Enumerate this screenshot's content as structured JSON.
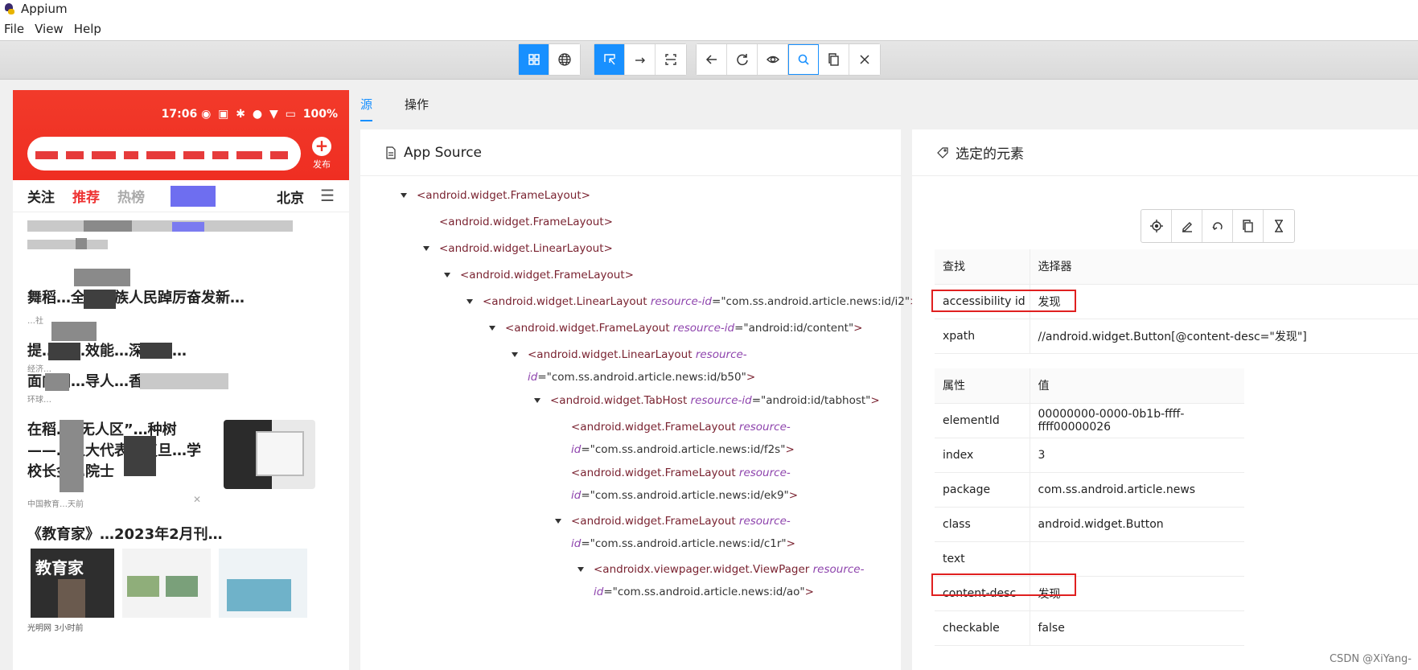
{
  "window": {
    "title": "Appium"
  },
  "menubar": {
    "items": [
      "File",
      "View",
      "Help"
    ]
  },
  "toolbar": {
    "group1": [
      "grid-icon",
      "globe-icon"
    ],
    "group2": [
      "select-element-icon",
      "swipe-icon",
      "tap-coordinates-icon"
    ],
    "group3": [
      "back-icon",
      "refresh-icon",
      "eye-icon",
      "search-icon",
      "copy-icon",
      "close-icon"
    ]
  },
  "device": {
    "status_time": "17:06",
    "status_battery": "100%",
    "publish_label": "发布",
    "tabs": [
      "关注",
      "推荐",
      "热榜"
    ],
    "city_tab": "北京",
    "news": [
      {
        "headline": "舞稻…全…各族人民踔厉奋发新…",
        "meta": "…社"
      },
      {
        "headline": "提…治…效能…深刻变…",
        "meta": "经济…"
      },
      {
        "headline": "面向国…导人…香乡…",
        "meta": "环球…"
      },
      {
        "headline": "在稻…“无人区”…种树——…人大代表、复旦…学校长金…院士",
        "meta": "中国教育…天前"
      },
      {
        "headline": "《教育家》…2023年2月刊…",
        "meta": "光明网  3小时前"
      }
    ],
    "thumb_caption": "教育家"
  },
  "tabs": {
    "source": "源",
    "actions": "操作"
  },
  "source_panel": {
    "title": "App Source",
    "nodes": [
      {
        "tag": "<android.widget.FrameLayout>"
      },
      {
        "tag": "<android.widget.FrameLayout>"
      },
      {
        "tag": "<android.widget.LinearLayout>"
      },
      {
        "tag": "<android.widget.FrameLayout>"
      },
      {
        "tag": "<android.widget.LinearLayout",
        "attr": "resource-id",
        "value": "\"com.ss.android.article.news:id/i2\"",
        "end": ">"
      },
      {
        "tag": "<android.widget.FrameLayout",
        "attr": "resource-id",
        "value": "\"android:id/content\"",
        "end": ">"
      },
      {
        "tag": "<android.widget.LinearLayout",
        "attr": "resource-",
        "line2_attr": "id",
        "value": "\"com.ss.android.article.news:id/b50\"",
        "end": ">"
      },
      {
        "tag": "<android.widget.TabHost",
        "attr": "resource-id",
        "value": "\"android:id/tabhost\"",
        "end": ">"
      },
      {
        "tag": "<android.widget.FrameLayout",
        "attr": "resource-",
        "line2_attr": "id",
        "value": "\"com.ss.android.article.news:id/f2s\"",
        "end": ">"
      },
      {
        "tag": "<android.widget.FrameLayout",
        "attr": "resource-",
        "line2_attr": "id",
        "value": "\"com.ss.android.article.news:id/ek9\"",
        "end": ">"
      },
      {
        "tag": "<android.widget.FrameLayout",
        "attr": "resource-",
        "line2_attr": "id",
        "value": "\"com.ss.android.article.news:id/c1r\"",
        "end": ">"
      },
      {
        "tag": "<androidx.viewpager.widget.ViewPager",
        "attr": "resource-",
        "line2_attr": "id",
        "value": "\"com.ss.android.article.news:id/ao\"",
        "end": ">"
      }
    ]
  },
  "selected_panel": {
    "title": "选定的元素",
    "actions": [
      "tap-element-icon",
      "send-keys-icon",
      "clear-icon",
      "copy-attributes-icon",
      "timing-icon"
    ],
    "find_header": [
      "查找",
      "选择器"
    ],
    "selectors": [
      {
        "key": "accessibility id",
        "value": "发现"
      },
      {
        "key": "xpath",
        "value": "//android.widget.Button[@content-desc=\"发现\"]"
      }
    ],
    "attr_header": [
      "属性",
      "值"
    ],
    "attributes": [
      {
        "key": "elementId",
        "value": "00000000-0000-0b1b-ffff-ffff00000026"
      },
      {
        "key": "index",
        "value": "3"
      },
      {
        "key": "package",
        "value": "com.ss.android.article.news"
      },
      {
        "key": "class",
        "value": "android.widget.Button"
      },
      {
        "key": "text",
        "value": ""
      },
      {
        "key": "content-desc",
        "value": "发现"
      },
      {
        "key": "checkable",
        "value": "false"
      }
    ]
  },
  "watermark": "CSDN @XiYang-",
  "colors": {
    "accent": "#1890ff",
    "tag": "#7a2331",
    "attr": "#8e44ad",
    "highlight": "#e02020",
    "device_header": "#ef2e22"
  }
}
